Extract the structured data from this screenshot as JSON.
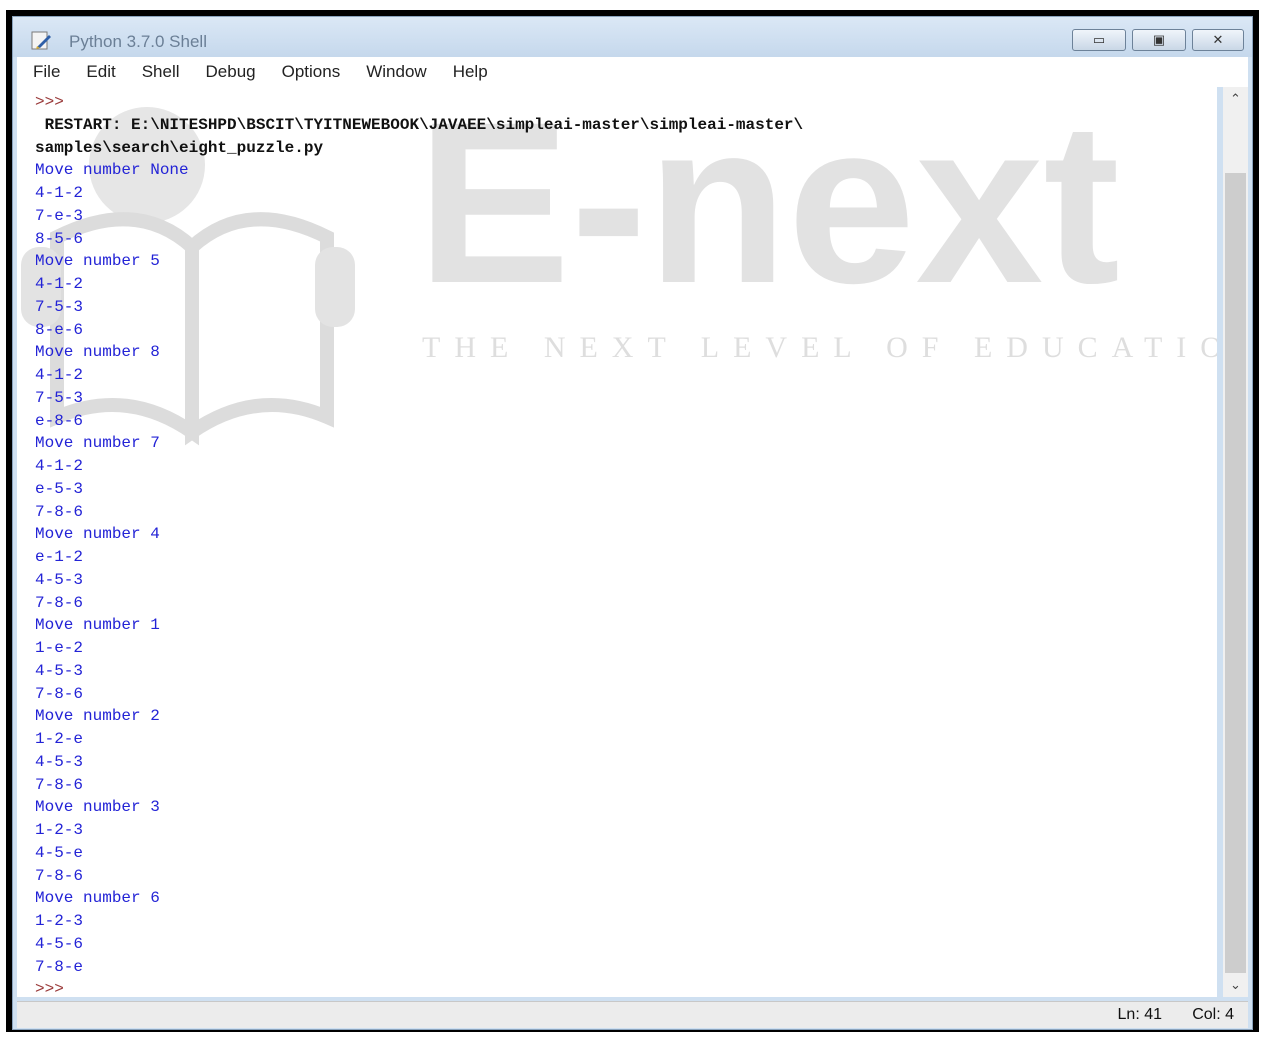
{
  "window": {
    "title": "Python 3.7.0 Shell",
    "minimize_glyph": "▭",
    "maximize_glyph": "▣",
    "close_glyph": "✕"
  },
  "menu": {
    "items": [
      "File",
      "Edit",
      "Shell",
      "Debug",
      "Options",
      "Window",
      "Help"
    ]
  },
  "shell": {
    "prompt_start": ">>>",
    "restart_line1": " RESTART: E:\\NITESHPD\\BSCIT\\TYITNEWEBOOK\\JAVAEE\\simpleai-master\\simpleai-master\\",
    "restart_line2": "samples\\search\\eight_puzzle.py",
    "output_lines": [
      "Move number None",
      "4-1-2",
      "7-e-3",
      "8-5-6",
      "Move number 5",
      "4-1-2",
      "7-5-3",
      "8-e-6",
      "Move number 8",
      "4-1-2",
      "7-5-3",
      "e-8-6",
      "Move number 7",
      "4-1-2",
      "e-5-3",
      "7-8-6",
      "Move number 4",
      "e-1-2",
      "4-5-3",
      "7-8-6",
      "Move number 1",
      "1-e-2",
      "4-5-3",
      "7-8-6",
      "Move number 2",
      "1-2-e",
      "4-5-3",
      "7-8-6",
      "Move number 3",
      "1-2-3",
      "4-5-e",
      "7-8-6",
      "Move number 6",
      "1-2-3",
      "4-5-6",
      "7-8-e"
    ],
    "prompt_end": ">>>"
  },
  "watermark": {
    "brand": "E-next",
    "tagline": "THE NEXT LEVEL OF EDUCATION"
  },
  "status": {
    "line": "Ln: 41",
    "col": "Col: 4"
  },
  "icons": {
    "app": "python-feather-icon",
    "scroll_up": "scroll-up-arrow-icon",
    "scroll_down": "scroll-down-arrow-icon"
  }
}
